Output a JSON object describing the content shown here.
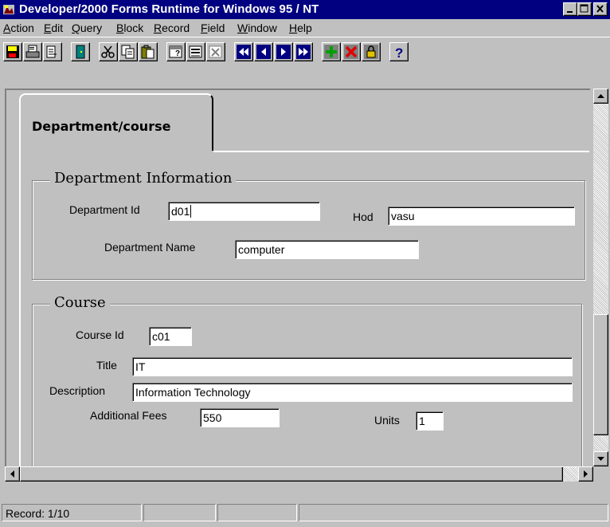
{
  "window": {
    "title": "Developer/2000 Forms Runtime for Windows 95 / NT",
    "controls": [
      "minimize-icon",
      "maximize-icon",
      "close-icon"
    ]
  },
  "menu": [
    {
      "label": "Action",
      "u": "A",
      "rest": "ction"
    },
    {
      "label": "Edit",
      "u": "E",
      "rest": "dit"
    },
    {
      "label": "Query",
      "u": "Q",
      "rest": "uery"
    },
    {
      "label": "Block",
      "u": "B",
      "rest": "lock"
    },
    {
      "label": "Record",
      "u": "R",
      "rest": "ecord"
    },
    {
      "label": "Field",
      "u": "F",
      "rest": "ield"
    },
    {
      "label": "Window",
      "u": "W",
      "rest": "indow"
    },
    {
      "label": "Help",
      "u": "H",
      "rest": "elp"
    }
  ],
  "toolbar": {
    "icons": [
      "save-icon",
      "print-icon",
      "print-setup-icon",
      "exit-icon",
      "cut-icon",
      "copy-icon",
      "paste-icon",
      "enter-query-icon",
      "execute-query-icon",
      "cancel-query-icon",
      "first-record-icon",
      "previous-record-icon",
      "next-record-icon",
      "last-record-icon",
      "insert-record-icon",
      "delete-record-icon",
      "lock-record-icon",
      "help-icon"
    ]
  },
  "tab": {
    "label": "Department/course"
  },
  "department": {
    "title": "Department Information",
    "id_label": "Department Id",
    "id_value": "d01",
    "hod_label": "Hod",
    "hod_value": "vasu",
    "name_label": "Department Name",
    "name_value": "computer"
  },
  "course": {
    "title": "Course",
    "id_label": "Course Id",
    "id_value": "c01",
    "title_label": "Title",
    "title_value": "IT",
    "desc_label": "Description",
    "desc_value": "Information Technology",
    "fees_label": "Additional Fees",
    "fees_value": "550",
    "units_label": "Units",
    "units_value": "1"
  },
  "status": {
    "record": "Record: 1/10"
  },
  "colors": {
    "titlebar": "#000080",
    "face": "#c0c0c0"
  }
}
